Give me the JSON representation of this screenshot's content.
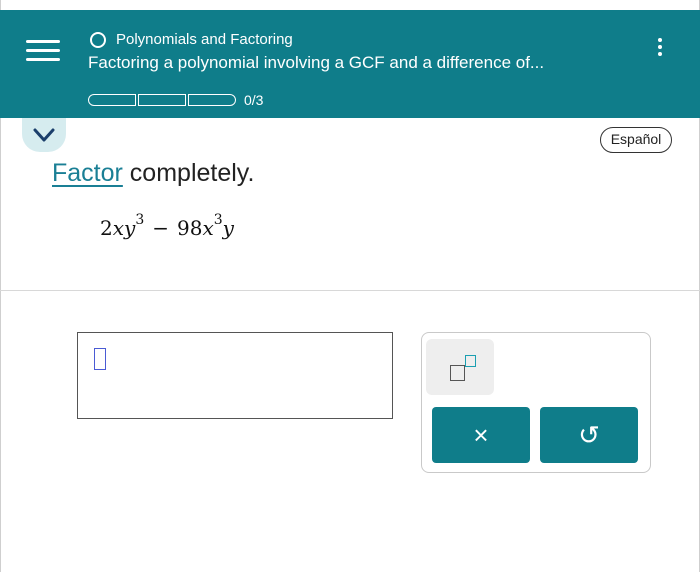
{
  "header": {
    "topic": "Polynomials and Factoring",
    "title": "Factoring a polynomial involving a GCF and a difference of...",
    "progress": {
      "text": "0/3",
      "completed": 0,
      "total": 3
    },
    "bg_color": "#0f7d8a"
  },
  "language_button": "Español",
  "question": {
    "link_word": "Factor",
    "rest": " completely.",
    "expression": {
      "t1_coef": "2",
      "t1_x": "x",
      "t1_y": "y",
      "t1_y_exp": "3",
      "op": "−",
      "t2_coef": "98",
      "t2_x": "x",
      "t2_x_exp": "3",
      "t2_y": "y"
    }
  },
  "tools": {
    "exponent_icon": "superscript-icon",
    "clear_label": "×",
    "undo_label": "↺"
  },
  "icons": {
    "menu": "hamburger-menu-icon",
    "more": "kebab-menu-icon",
    "collapse": "chevron-down-icon",
    "topic": "circle-icon"
  }
}
